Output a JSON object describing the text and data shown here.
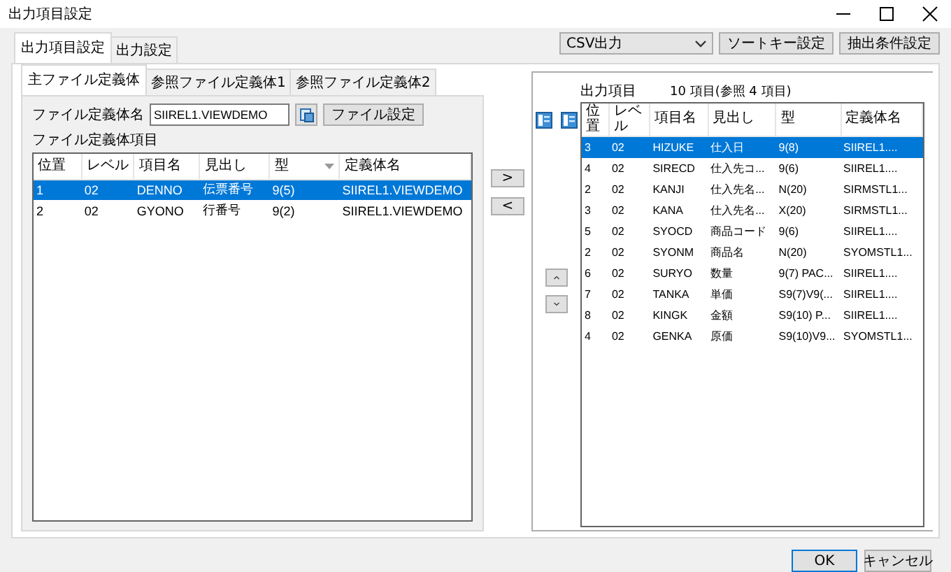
{
  "window": {
    "title": "出力項目設定"
  },
  "toolbar": {
    "output_format": "CSV出力",
    "buttons": [
      "ソートキー設定",
      "抽出条件設定"
    ]
  },
  "tabs": [
    {
      "label": "出力項目設定",
      "selected": true
    },
    {
      "label": "出力設定",
      "selected": false
    }
  ],
  "file_tabs": [
    {
      "label": "主ファイル定義体",
      "selected": true
    },
    {
      "label": "参照ファイル定義体1",
      "selected": false
    },
    {
      "label": "参照ファイル定義体2",
      "selected": false
    }
  ],
  "file_definition": {
    "label": "ファイル定義体名",
    "value": "SIIREL1.VIEWDEMO",
    "button": "ファイル設定"
  },
  "source_table": {
    "title": "ファイル定義体項目",
    "columns": [
      {
        "label": "位置",
        "sorted": false
      },
      {
        "label": "レベル",
        "sorted": false
      },
      {
        "label": "項目名",
        "sorted": false
      },
      {
        "label": "見出し",
        "sorted": false
      },
      {
        "label": "型",
        "sorted": true
      },
      {
        "label": "定義体名",
        "sorted": false
      }
    ],
    "rows": [
      {
        "cells": [
          "1",
          "02",
          "DENNO",
          "伝票番号",
          "9(5)",
          "SIIREL1.VIEWDEMO"
        ],
        "selected": true
      },
      {
        "cells": [
          "2",
          "02",
          "GYONO",
          "行番号",
          "9(2)",
          "SIIREL1.VIEWDEMO"
        ],
        "selected": false
      }
    ]
  },
  "move_buttons": [
    ">",
    "<"
  ],
  "output_table": {
    "title": "出力項目",
    "count": "10 項目(参照 4 項目)",
    "columns": [
      {
        "label": "位置",
        "sorted": false
      },
      {
        "label": "レベル",
        "sorted": false
      },
      {
        "label": "項目名",
        "sorted": false
      },
      {
        "label": "見出し",
        "sorted": false
      },
      {
        "label": "型",
        "sorted": false
      },
      {
        "label": "定義体名",
        "sorted": false
      }
    ],
    "rows": [
      {
        "cells": [
          "3",
          "02",
          "HIZUKE",
          "仕入日",
          "9(8)",
          "SIIREL1...."
        ],
        "selected": true
      },
      {
        "cells": [
          "4",
          "02",
          "SIRECD",
          "仕入先コ...",
          "9(6)",
          "SIIREL1...."
        ],
        "selected": false
      },
      {
        "cells": [
          "2",
          "02",
          "KANJI",
          "仕入先名...",
          "N(20)",
          "SIRMSTL1..."
        ],
        "selected": false
      },
      {
        "cells": [
          "3",
          "02",
          "KANA",
          "仕入先名...",
          "X(20)",
          "SIRMSTL1..."
        ],
        "selected": false
      },
      {
        "cells": [
          "5",
          "02",
          "SYOCD",
          "商品コード",
          "9(6)",
          "SIIREL1...."
        ],
        "selected": false
      },
      {
        "cells": [
          "2",
          "02",
          "SYONM",
          "商品名",
          "N(20)",
          "SYOMSTL1..."
        ],
        "selected": false
      },
      {
        "cells": [
          "6",
          "02",
          "SURYO",
          "数量",
          "9(7) PAC...",
          "SIIREL1...."
        ],
        "selected": false
      },
      {
        "cells": [
          "7",
          "02",
          "TANKA",
          "単価",
          "S9(7)V9(...",
          "SIIREL1...."
        ],
        "selected": false
      },
      {
        "cells": [
          "8",
          "02",
          "KINGK",
          "金額",
          "S9(10) P...",
          "SIIREL1...."
        ],
        "selected": false
      },
      {
        "cells": [
          "4",
          "02",
          "GENKA",
          "原価",
          "S9(10)V9...",
          "SYOMSTL1..."
        ],
        "selected": false
      }
    ]
  },
  "footer": {
    "buttons": [
      "OK",
      "キャンセル"
    ]
  }
}
